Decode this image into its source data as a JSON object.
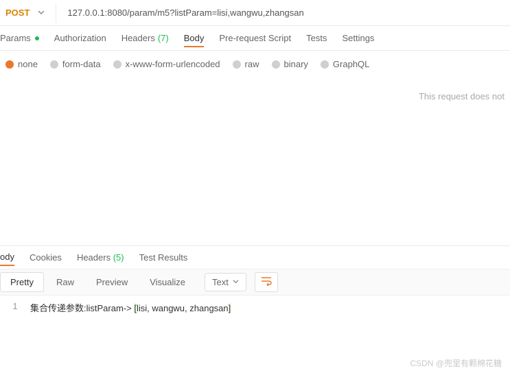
{
  "request": {
    "method": "POST",
    "url": "127.0.0.1:8080/param/m5?listParam=lisi,wangwu,zhangsan"
  },
  "tabs": {
    "params": "Params",
    "authorization": "Authorization",
    "headers": "Headers",
    "headers_count": "(7)",
    "body": "Body",
    "prerequest": "Pre-request Script",
    "tests": "Tests",
    "settings": "Settings"
  },
  "body_types": {
    "none": "none",
    "formdata": "form-data",
    "urlencoded": "x-www-form-urlencoded",
    "raw": "raw",
    "binary": "binary",
    "graphql": "GraphQL"
  },
  "empty_msg": "This request does not",
  "response_tabs": {
    "body": "ody",
    "cookies": "Cookies",
    "headers": "Headers",
    "headers_count": "(5)",
    "tests": "Test Results"
  },
  "view_modes": {
    "pretty": "Pretty",
    "raw": "Raw",
    "preview": "Preview",
    "visualize": "Visualize",
    "format": "Text"
  },
  "response_body": {
    "line": "1",
    "prefix": "集合传递参数:listParam-> ",
    "bracket_open": "[",
    "content": "lisi, wangwu, zhangsan",
    "bracket_close": "]"
  },
  "watermark": "CSDN @兜里有颗棉花糖"
}
